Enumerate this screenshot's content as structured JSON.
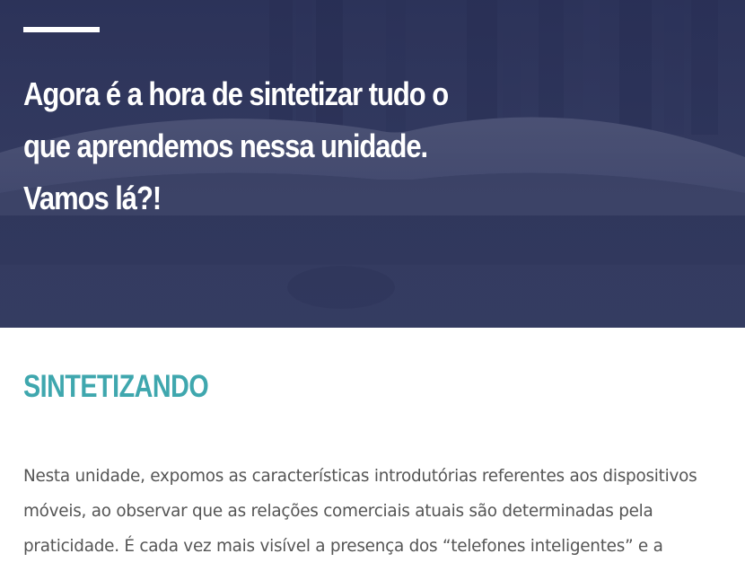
{
  "hero": {
    "title": "Agora é a hora de sintetizar tudo o que aprendemos nessa unidade. Vamos lá?!"
  },
  "section": {
    "heading": "SINTETIZANDO",
    "paragraph": "Nesta unidade, expomos as características introdutórias referentes aos dispositivos móveis, ao observar que as relações comerciais atuais são determinadas pela praticidade. É cada vez mais visível a presença dos “telefones inteligentes” e a"
  },
  "colors": {
    "hero_overlay": "#2a3157",
    "heading_accent": "#3fa7ae",
    "body_text": "#555555"
  }
}
